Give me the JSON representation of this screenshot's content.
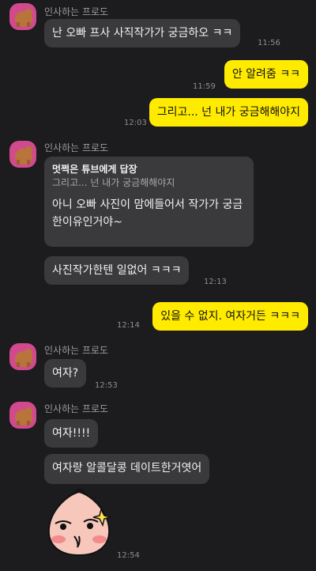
{
  "chat": {
    "sender_name": "인사하는 프로도",
    "messages": [
      {
        "text": "난 오빠 프사 사직작가가 궁금하오 ㅋㅋ",
        "time": "11:56"
      },
      {
        "text": "안 알려줌 ㅋㅋ",
        "time": "11:59"
      },
      {
        "text": "그리고... 넌 내가 궁금해해야지",
        "time": "12:03"
      },
      {
        "reply_to": "멋쩍은 튜브에게 답장",
        "quoted": "그리고... 넌 내가 궁금해해야지",
        "text": "아니 오빠 사진이 맘에들어서 작가가 궁금한이유인거야~"
      },
      {
        "text": "사진작가한텐 일없어 ㅋㅋㅋ",
        "time": "12:13"
      },
      {
        "text": "있을 수 없지. 여자거든 ㅋㅋㅋ",
        "time": "12:14"
      },
      {
        "text": "여자?",
        "time": "12:53"
      },
      {
        "text": "여자!!!!"
      },
      {
        "text": "여자랑 알콜달콩 데이트한거엿어"
      },
      {
        "sticker": "apeach-sticker",
        "time": "12:54"
      }
    ]
  },
  "colors": {
    "background": "#1c1c1e",
    "incoming_bubble": "#3a3a3c",
    "outgoing_bubble": "#ffeb00",
    "avatar_bg": "#d14a8e",
    "sticker_peach": "#f7c7bc"
  },
  "icons": {
    "avatar": "bear-avatar-icon",
    "sticker": "peach-character-sticker"
  }
}
